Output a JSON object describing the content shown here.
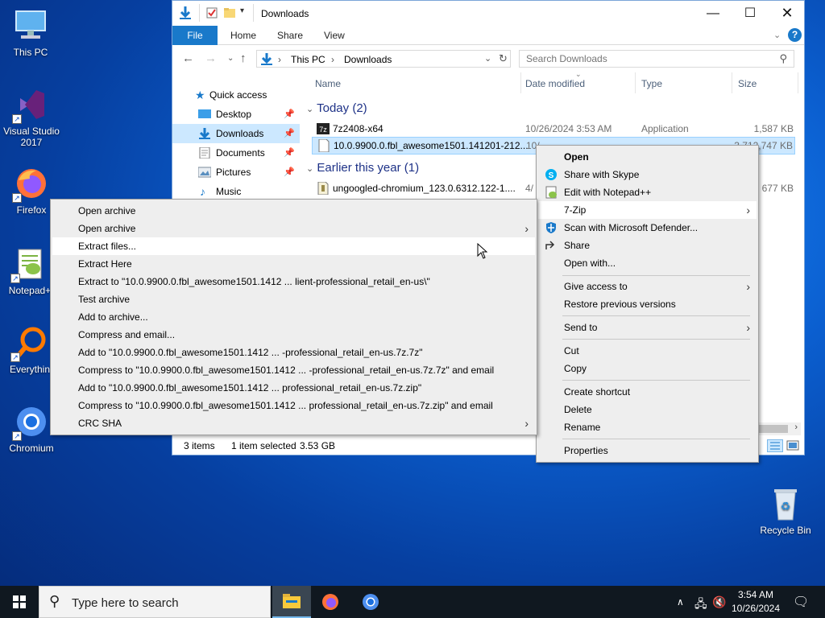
{
  "desktop": {
    "icons": [
      {
        "label": "This PC"
      },
      {
        "label": "Visual Studio 2017"
      },
      {
        "label": "Firefox"
      },
      {
        "label": "Notepad+"
      },
      {
        "label": "Everythin"
      },
      {
        "label": "Chromium"
      },
      {
        "label": "Recycle Bin"
      }
    ]
  },
  "explorer": {
    "title": "Downloads",
    "ribbon_tabs": [
      "File",
      "Home",
      "Share",
      "View"
    ],
    "address": {
      "crumbs": [
        "This PC",
        "Downloads"
      ],
      "separator": "›"
    },
    "search": {
      "placeholder": "Search Downloads"
    },
    "nav": {
      "items": [
        {
          "label": "Quick access",
          "icon": "star-icon"
        },
        {
          "label": "Desktop",
          "icon": "desktop-icon"
        },
        {
          "label": "Downloads",
          "icon": "download-icon"
        },
        {
          "label": "Documents",
          "icon": "documents-icon"
        },
        {
          "label": "Pictures",
          "icon": "pictures-icon"
        },
        {
          "label": "Music",
          "icon": "music-icon"
        }
      ]
    },
    "columns": {
      "name": "Name",
      "date": "Date modified",
      "type": "Type",
      "size": "Size"
    },
    "groups": [
      {
        "label": "Today (2)"
      },
      {
        "label": "Earlier this year (1)"
      }
    ],
    "files": [
      {
        "name": "7z2408-x64",
        "date": "10/26/2024 3:53 AM",
        "type": "Application",
        "size": "1,587 KB"
      },
      {
        "name": "10.0.9900.0.fbl_awesome1501.141201-212...",
        "date": "10/",
        "type": "",
        "size": "3,712,747 KB"
      },
      {
        "name": "ungoogled-chromium_123.0.6312.122-1....",
        "date": "4/",
        "type": "",
        "size": "677 KB"
      }
    ],
    "status": {
      "items": "3 items",
      "selected": "1 item selected",
      "size": "3.53 GB"
    }
  },
  "main_menu": {
    "items": [
      {
        "label": "Open",
        "bold": true
      },
      {
        "label": "Share with Skype",
        "icon": "skype-icon"
      },
      {
        "label": "Edit with Notepad++",
        "icon": "notepadpp-icon"
      },
      {
        "label": "7-Zip",
        "submenu": true
      },
      {
        "label": "Scan with Microsoft Defender...",
        "icon": "defender-icon"
      },
      {
        "label": "Share",
        "icon": "share-icon"
      },
      {
        "label": "Open with..."
      },
      {
        "label": "Give access to",
        "submenu": true
      },
      {
        "label": "Restore previous versions"
      },
      {
        "label": "Send to",
        "submenu": true
      },
      {
        "label": "Cut"
      },
      {
        "label": "Copy"
      },
      {
        "label": "Create shortcut"
      },
      {
        "label": "Delete"
      },
      {
        "label": "Rename"
      },
      {
        "label": "Properties"
      }
    ]
  },
  "zip_menu": {
    "items": [
      {
        "label": "Open archive"
      },
      {
        "label": "Open archive",
        "submenu": true
      },
      {
        "label": "Extract files..."
      },
      {
        "label": "Extract Here"
      },
      {
        "label": "Extract to \"10.0.9900.0.fbl_awesome1501.1412 ... lient-professional_retail_en-us\\\""
      },
      {
        "label": "Test archive"
      },
      {
        "label": "Add to archive..."
      },
      {
        "label": "Compress and email..."
      },
      {
        "label": "Add to \"10.0.9900.0.fbl_awesome1501.1412 ... -professional_retail_en-us.7z.7z\""
      },
      {
        "label": "Compress to \"10.0.9900.0.fbl_awesome1501.1412 ... -professional_retail_en-us.7z.7z\" and email"
      },
      {
        "label": "Add to \"10.0.9900.0.fbl_awesome1501.1412 ... professional_retail_en-us.7z.zip\""
      },
      {
        "label": "Compress to \"10.0.9900.0.fbl_awesome1501.1412 ... professional_retail_en-us.7z.zip\" and email"
      },
      {
        "label": "CRC SHA",
        "submenu": true
      }
    ]
  },
  "taskbar": {
    "search_placeholder": "Type here to search",
    "time": "3:54 AM",
    "date": "10/26/2024"
  },
  "colors": {
    "accent": "#1979ca",
    "selection": "#cce8ff",
    "taskbar": "#101820",
    "desktop": "#0b5fd0"
  }
}
